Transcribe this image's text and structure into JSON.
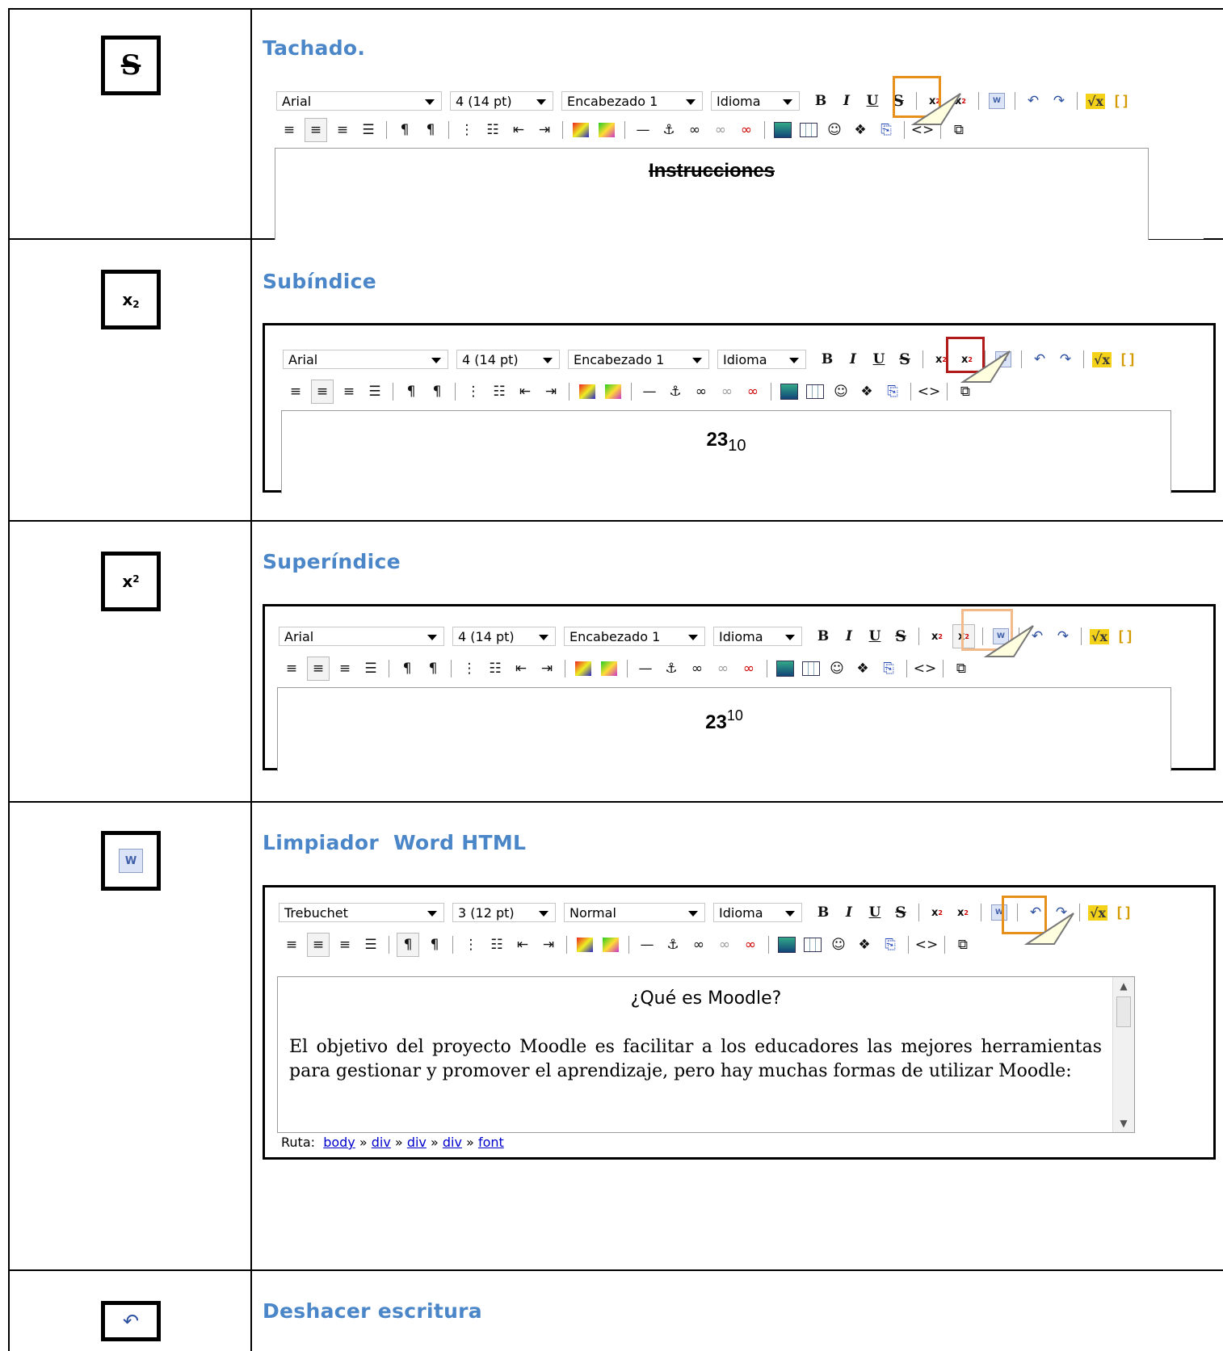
{
  "sections": [
    {
      "title": "Tachado.",
      "icon": "strikethrough-icon"
    },
    {
      "title": "Subíndice",
      "icon": "subscript-icon"
    },
    {
      "title": "Superíndice",
      "icon": "superscript-icon"
    },
    {
      "title": "Limpiador  Word HTML",
      "icon": "word-cleaner-icon"
    },
    {
      "title": "Deshacer escritura",
      "icon": "undo-icon"
    }
  ],
  "editors": [
    {
      "font": "Arial",
      "size": "4 (14 pt)",
      "style": "Encabezado 1",
      "lang": "Idioma",
      "content": "Instrucciones"
    },
    {
      "font": "Arial",
      "size": "4 (14 pt)",
      "style": "Encabezado 1",
      "lang": "Idioma",
      "content_base": "23",
      "content_script": "10"
    },
    {
      "font": "Arial",
      "size": "4 (14 pt)",
      "style": "Encabezado 1",
      "lang": "Idioma",
      "content_base": "23",
      "content_script": "10"
    },
    {
      "font": "Trebuchet",
      "size": "3 (12 pt)",
      "style": "Normal",
      "lang": "Idioma",
      "heading": "¿Qué es Moodle?",
      "paragraph": "El objetivo del proyecto Moodle es facilitar a los educadores las mejores herramientas para gestionar y promover el aprendizaje, pero hay muchas formas de utilizar Moodle:",
      "path_label": "Ruta:",
      "path": [
        "body",
        "div",
        "div",
        "div",
        "font"
      ],
      "path_sep": "»"
    }
  ],
  "toolbar_glyphs": {
    "bold": "B",
    "italic": "I",
    "underline": "U",
    "strike": "S",
    "sub_base": "x",
    "sub_small": "2",
    "sup_base": "x",
    "sup_small": "2",
    "source": "<>"
  },
  "colors": {
    "title": "#4a86c8",
    "highlight_orange": "#e8901c",
    "highlight_red": "#b11a1a",
    "highlight_peach": "#f2b98a"
  }
}
